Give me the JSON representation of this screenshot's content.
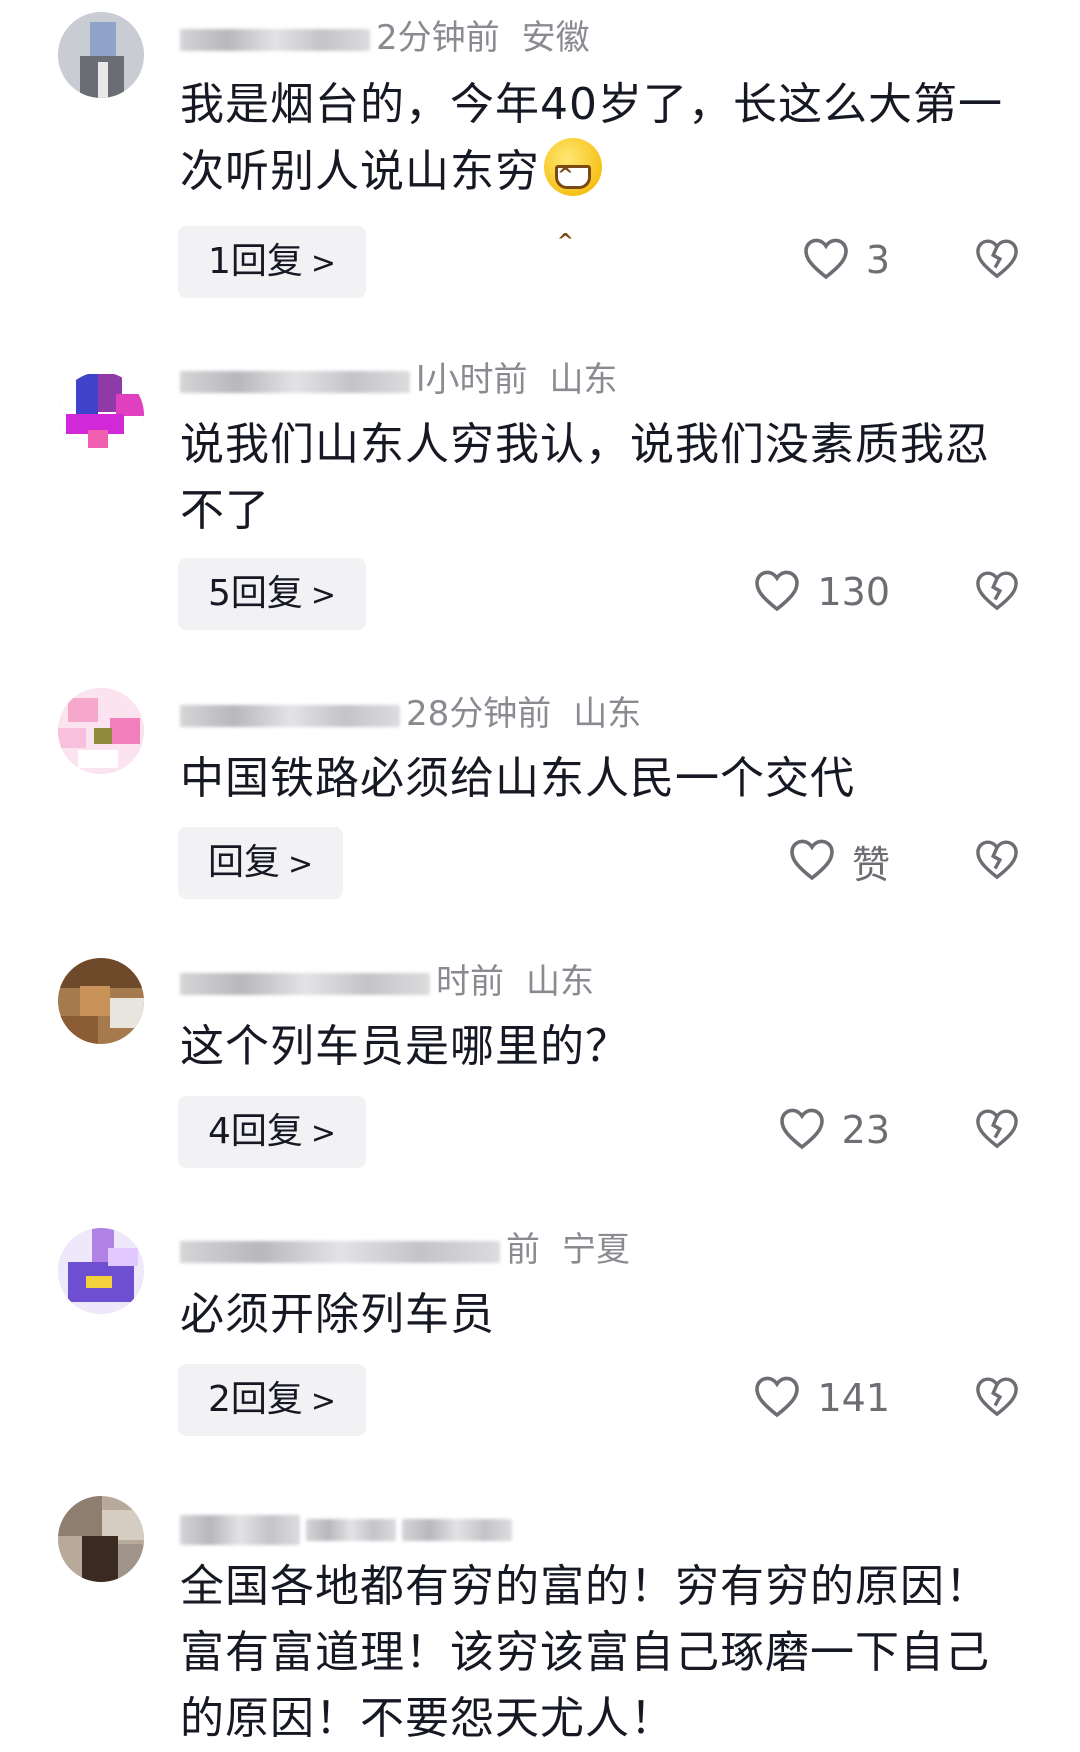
{
  "comments": [
    {
      "time": "2分钟前",
      "location": "安徽",
      "text": "我是烟台的，今年40岁了，长这么大第一次听别人说山东穷",
      "emoji": "grinning-face",
      "reply_label": "1回复",
      "like_label": "3"
    },
    {
      "time": "l小时前",
      "location": "山东",
      "text": "说我们山东人穷我认，说我们没素质我忍不了",
      "reply_label": "5回复",
      "like_label": "130"
    },
    {
      "time": "28分钟前",
      "location": "山东",
      "text": "中国铁路必须给山东人民一个交代",
      "reply_label": "回复",
      "like_label": "赞"
    },
    {
      "time": "时前",
      "location": "山东",
      "text": "这个列车员是哪里的？",
      "reply_label": "4回复",
      "like_label": "23"
    },
    {
      "time": "前",
      "location": "宁夏",
      "text": "必须开除列车员",
      "reply_label": "2回复",
      "like_label": "141"
    },
    {
      "time": "",
      "location": "",
      "text": "全国各地都有穷的富的！穷有穷的原因！富有富道理！该穷该富自己琢磨一下自己的原因！不要怨天尤人！"
    }
  ],
  "icons": {
    "like": "heart-outline-icon",
    "dislike": "broken-heart-icon",
    "chevron": "chevron-right-icon"
  },
  "colors": {
    "text": "#161823",
    "meta": "#8a8b91",
    "reply_bg": "#f2f2f4",
    "icon": "#6d6e74"
  }
}
